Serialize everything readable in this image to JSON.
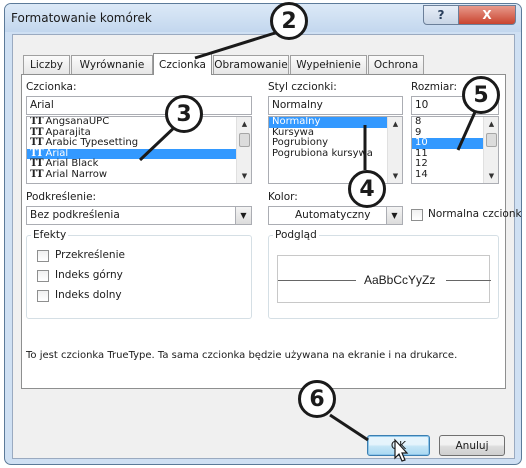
{
  "window": {
    "title": "Formatowanie komórek",
    "help_label": "?",
    "close_label": "X"
  },
  "tabs": [
    {
      "label": "Liczby"
    },
    {
      "label": "Wyrównanie"
    },
    {
      "label": "Czcionka"
    },
    {
      "label": "Obramowanie"
    },
    {
      "label": "Wypełnienie"
    },
    {
      "label": "Ochrona"
    }
  ],
  "font": {
    "label": "Czcionka:",
    "value": "Arial",
    "items": [
      "AngsanaUPC",
      "Aparajita",
      "Arabic Typesetting",
      "Arial",
      "Arial Black",
      "Arial Narrow"
    ],
    "selected": "Arial"
  },
  "style": {
    "label": "Styl czcionki:",
    "value": "Normalny",
    "items": [
      "Normalny",
      "Kursywa",
      "Pogrubiony",
      "Pogrubiona kursywa"
    ],
    "selected": "Normalny"
  },
  "size": {
    "label": "Rozmiar:",
    "value": "10",
    "items": [
      "8",
      "9",
      "10",
      "11",
      "12",
      "14"
    ],
    "selected": "10"
  },
  "underline": {
    "label": "Podkreślenie:",
    "value": "Bez podkreślenia"
  },
  "color": {
    "label": "Kolor:",
    "value": "Automatyczny"
  },
  "normal_font": {
    "label": "Normalna czcionka",
    "checked": false
  },
  "effects": {
    "title": "Efekty",
    "items": [
      {
        "label": "Przekreślenie",
        "checked": false
      },
      {
        "label": "Indeks górny",
        "checked": false
      },
      {
        "label": "Indeks dolny",
        "checked": false
      }
    ]
  },
  "preview": {
    "title": "Podgląd",
    "sample": "AaBbCcYyZz"
  },
  "note": "To jest czcionka TrueType. Ta sama czcionka będzie używana na ekranie i na drukarce.",
  "buttons": {
    "ok": "OK",
    "cancel": "Anuluj"
  },
  "callouts": [
    "2",
    "3",
    "4",
    "5",
    "6"
  ]
}
